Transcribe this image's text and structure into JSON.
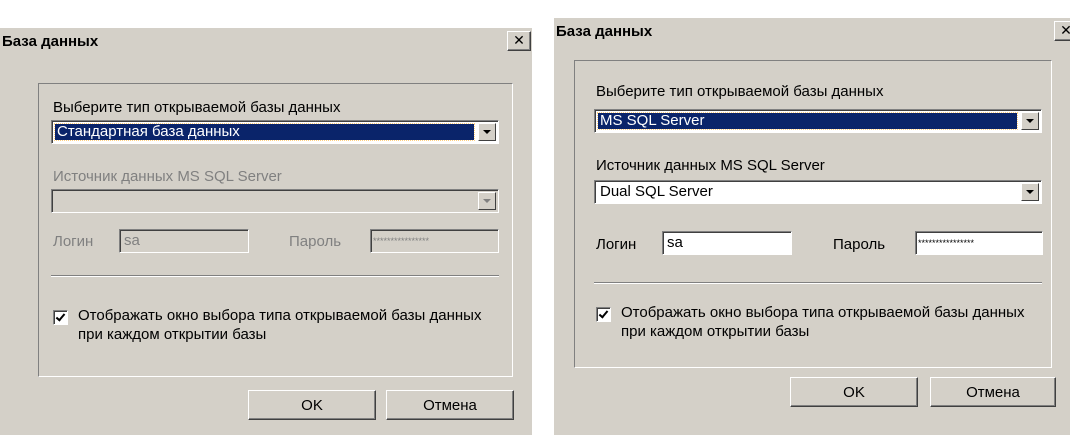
{
  "dialogs": [
    {
      "title": "База данных",
      "close_glyph": "✕",
      "db_type_label": "Выберите тип открываемой базы данных",
      "db_type_value": "Стандартная база данных",
      "source_label": "Источник данных MS SQL Server",
      "source_value": "",
      "login_label": "Логин",
      "login_value": "sa",
      "password_label": "Пароль",
      "password_value": "****************",
      "checkbox_label": "Отображать окно выбора типа открываемой базы данных при каждом открытии базы",
      "checkbox_checked": true,
      "ok_label": "OK",
      "cancel_label": "Отмена",
      "sql_fields_enabled": false
    },
    {
      "title": "База данных",
      "close_glyph": "✕",
      "db_type_label": "Выберите тип открываемой базы данных",
      "db_type_value": "MS SQL Server",
      "source_label": "Источник данных MS SQL Server",
      "source_value": "Dual SQL Server",
      "login_label": "Логин",
      "login_value": "sa",
      "password_label": "Пароль",
      "password_value": "****************",
      "checkbox_label": "Отображать окно выбора типа открываемой базы данных при каждом открытии базы",
      "checkbox_checked": true,
      "ok_label": "OK",
      "cancel_label": "Отмена",
      "sql_fields_enabled": true
    }
  ]
}
